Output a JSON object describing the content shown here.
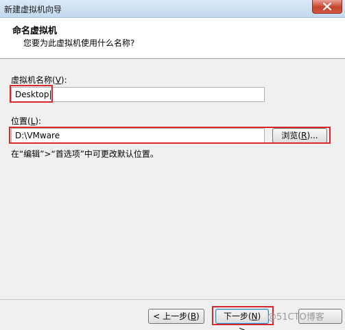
{
  "window": {
    "title": "新建虚拟机向导"
  },
  "header": {
    "title": "命名虚拟机",
    "subtitle": "您要为此虚拟机使用什么名称?"
  },
  "name_field": {
    "label_prefix": "虚拟机名称(",
    "accel": "V",
    "label_suffix": "):",
    "value": "Desktop"
  },
  "location_field": {
    "label_prefix": "位置(",
    "accel": "L",
    "label_suffix": "):",
    "value": "D:\\VMware"
  },
  "browse_button": {
    "prefix": "浏览(",
    "accel": "R",
    "suffix": ")..."
  },
  "hint": "在“编辑”>“首选项”中可更改默认位置。",
  "back_button": {
    "prefix": "< 上一步(",
    "accel": "B",
    "suffix": ")"
  },
  "next_button": {
    "prefix": "下一步(",
    "accel": "N",
    "suffix": ") >"
  },
  "watermark": "@51CTO博客",
  "colors": {
    "highlight": "#d9262a",
    "close": "#c7432b"
  }
}
